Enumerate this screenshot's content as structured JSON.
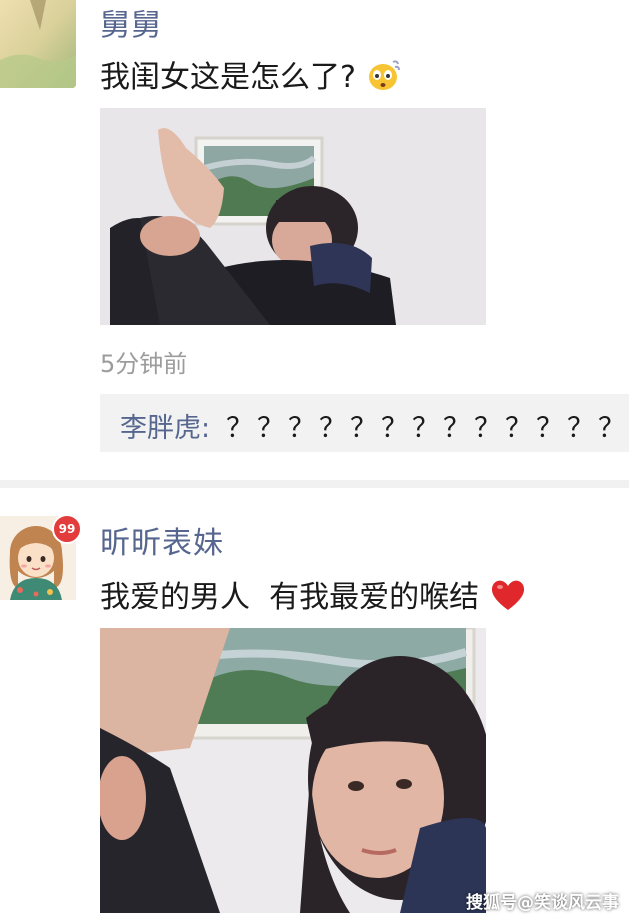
{
  "post1": {
    "username": "舅舅",
    "message": "我闺女这是怎么了?",
    "emoji": "flushed-face-emoji",
    "timestamp": "5分钟前",
    "comment": {
      "author": "李胖虎:",
      "text": "？？？？？？？？？？？？？"
    }
  },
  "post2": {
    "username": "昕昕表妹",
    "message": "我爱的男人  有我最爱的喉结",
    "emoji": "red-heart-emoji",
    "badge": "99"
  },
  "watermark": "搜狐号@笑谈风云事",
  "colors": {
    "username": "#56668f",
    "message": "#1a1a1a",
    "timestamp": "#9c9c9c",
    "comment_bg": "#f2f2f2",
    "divider": "#f1f1f1",
    "heart": "#e0282c",
    "badge": "#e23c3c"
  }
}
